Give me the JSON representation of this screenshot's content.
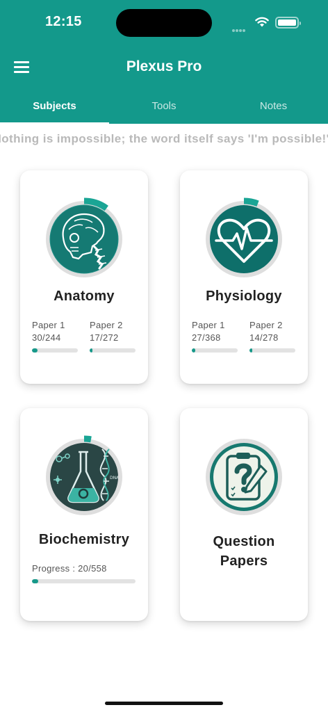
{
  "status_bar": {
    "time": "12:15"
  },
  "app_bar": {
    "title": "Plexus Pro"
  },
  "tabs": [
    {
      "label": "Subjects",
      "active": true
    },
    {
      "label": "Tools",
      "active": false
    },
    {
      "label": "Notes",
      "active": false
    }
  ],
  "quote": "Nothing is impossible; the word itself says 'I'm possible!'",
  "theme": {
    "primary": "#13998b",
    "progress": "#17998a",
    "track": "#e2e2e2"
  },
  "subjects": [
    {
      "title": "Anatomy",
      "icon": "skull-spine-icon",
      "papers": [
        {
          "name": "Paper 1",
          "count": "30/244",
          "done": 30,
          "total": 244
        },
        {
          "name": "Paper 2",
          "count": "17/272",
          "done": 17,
          "total": 272
        }
      ]
    },
    {
      "title": "Physiology",
      "icon": "heartbeat-icon",
      "papers": [
        {
          "name": "Paper 1",
          "count": "27/368",
          "done": 27,
          "total": 368
        },
        {
          "name": "Paper 2",
          "count": "14/278",
          "done": 14,
          "total": 278
        }
      ]
    },
    {
      "title": "Biochemistry",
      "icon": "flask-dna-icon",
      "dna_text": "DNA",
      "progress_label": "Progress : 20/558",
      "done": 20,
      "total": 558
    },
    {
      "title_line1": "Question",
      "title_line2": "Papers",
      "icon": "question-clipboard-icon"
    }
  ]
}
